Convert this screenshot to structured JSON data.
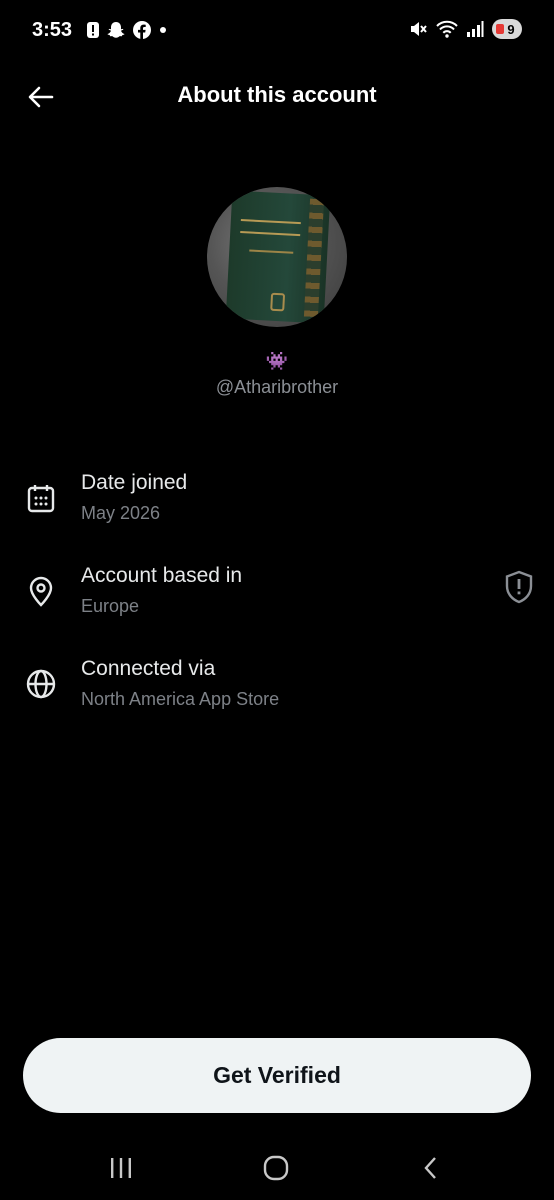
{
  "status_bar": {
    "time": "3:53",
    "battery": "9",
    "icons_left": [
      "alert-icon",
      "snapchat-icon",
      "facebook-icon",
      "dot-icon"
    ],
    "icons_right": [
      "mute-icon",
      "wifi-icon",
      "signal-icon",
      "battery-icon"
    ]
  },
  "header": {
    "title": "About this account",
    "back_icon": "arrow-left-icon"
  },
  "profile": {
    "badge_emoji": "👾",
    "handle": "@Atharibrother"
  },
  "details": [
    {
      "icon": "calendar-icon",
      "label": "Date joined",
      "value": "May 2026"
    },
    {
      "icon": "location-pin-icon",
      "label": "Account based in",
      "value": "Europe",
      "right_icon": "shield-alert-icon"
    },
    {
      "icon": "globe-icon",
      "label": "Connected via",
      "value": "North America App Store"
    }
  ],
  "actions": {
    "get_verified": "Get Verified"
  },
  "nav_bar": {
    "icons": [
      "recents-icon",
      "home-icon",
      "back-icon"
    ]
  },
  "colors": {
    "background": "#000000",
    "primary_text": "#e7e9ea",
    "secondary_text": "#7d8187",
    "button_bg": "#eff3f4"
  }
}
